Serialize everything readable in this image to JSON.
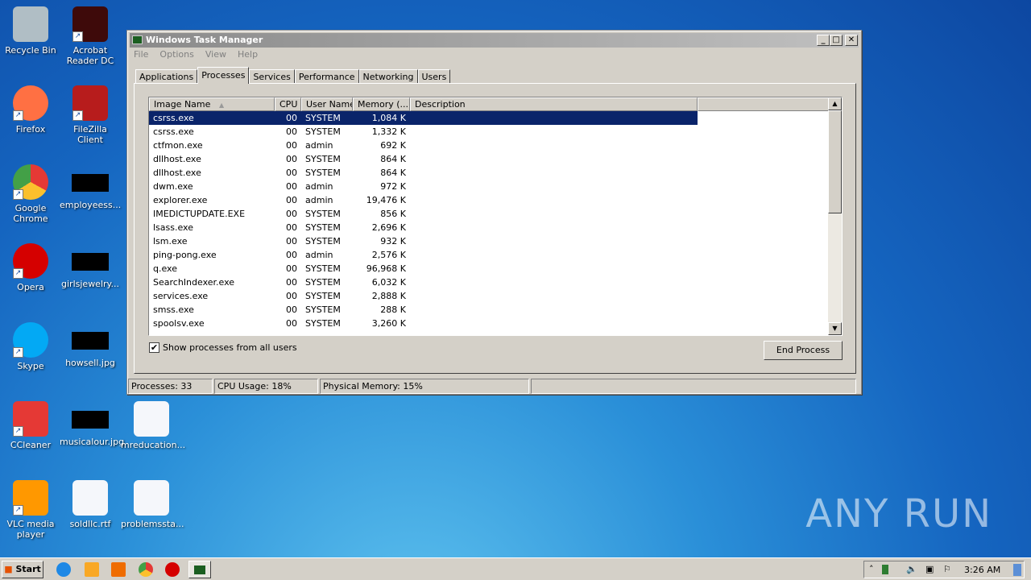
{
  "desktop": {
    "icons": [
      {
        "label": "Recycle Bin",
        "icon": "recycle-bin-icon"
      },
      {
        "label": "Acrobat Reader DC",
        "icon": "acrobat-icon"
      },
      {
        "label": "Firefox",
        "icon": "firefox-icon"
      },
      {
        "label": "FileZilla Client",
        "icon": "filezilla-icon"
      },
      {
        "label": "Google Chrome",
        "icon": "chrome-icon"
      },
      {
        "label": "employeess...",
        "icon": "image-file-icon"
      },
      {
        "label": "Opera",
        "icon": "opera-icon"
      },
      {
        "label": "girlsjewelry...",
        "icon": "image-file-icon"
      },
      {
        "label": "Skype",
        "icon": "skype-icon"
      },
      {
        "label": "howsell.jpg",
        "icon": "image-file-icon"
      },
      {
        "label": "CCleaner",
        "icon": "ccleaner-icon"
      },
      {
        "label": "musicalour.jpg",
        "icon": "image-file-icon"
      },
      {
        "label": "mreducation...",
        "icon": "word-doc-icon"
      },
      {
        "label": "VLC media player",
        "icon": "vlc-icon"
      },
      {
        "label": "soldllc.rtf",
        "icon": "word-doc-icon"
      },
      {
        "label": "problemssta...",
        "icon": "word-doc-icon"
      }
    ]
  },
  "window": {
    "title": "Windows Task Manager",
    "menu": [
      "File",
      "Options",
      "View",
      "Help"
    ],
    "tabs": [
      "Applications",
      "Processes",
      "Services",
      "Performance",
      "Networking",
      "Users"
    ],
    "active_tab": "Processes",
    "columns": [
      "Image Name",
      "CPU",
      "User Name",
      "Memory (...",
      "Description"
    ],
    "rows": [
      [
        "csrss.exe",
        "00",
        "SYSTEM",
        "1,084 K",
        ""
      ],
      [
        "csrss.exe",
        "00",
        "SYSTEM",
        "1,332 K",
        ""
      ],
      [
        "ctfmon.exe",
        "00",
        "admin",
        "692 K",
        ""
      ],
      [
        "dllhost.exe",
        "00",
        "SYSTEM",
        "864 K",
        ""
      ],
      [
        "dllhost.exe",
        "00",
        "SYSTEM",
        "864 K",
        ""
      ],
      [
        "dwm.exe",
        "00",
        "admin",
        "972 K",
        ""
      ],
      [
        "explorer.exe",
        "00",
        "admin",
        "19,476 K",
        ""
      ],
      [
        "IMEDICTUPDATE.EXE",
        "00",
        "SYSTEM",
        "856 K",
        ""
      ],
      [
        "lsass.exe",
        "00",
        "SYSTEM",
        "2,696 K",
        ""
      ],
      [
        "lsm.exe",
        "00",
        "SYSTEM",
        "932 K",
        ""
      ],
      [
        "ping-pong.exe",
        "00",
        "admin",
        "2,576 K",
        ""
      ],
      [
        "q.exe",
        "00",
        "SYSTEM",
        "96,968 K",
        ""
      ],
      [
        "SearchIndexer.exe",
        "00",
        "SYSTEM",
        "6,032 K",
        ""
      ],
      [
        "services.exe",
        "00",
        "SYSTEM",
        "2,888 K",
        ""
      ],
      [
        "smss.exe",
        "00",
        "SYSTEM",
        "288 K",
        ""
      ],
      [
        "spoolsv.exe",
        "00",
        "SYSTEM",
        "3,260 K",
        ""
      ]
    ],
    "show_all_label": "Show processes from all users",
    "show_all_checked": true,
    "end_process": "End Process",
    "status": {
      "processes": "Processes: 33",
      "cpu": "CPU Usage: 18%",
      "memory": "Physical Memory: 15%"
    }
  },
  "taskbar": {
    "start": "Start",
    "clock": "3:26 AM"
  },
  "watermark": "ANY RUN"
}
